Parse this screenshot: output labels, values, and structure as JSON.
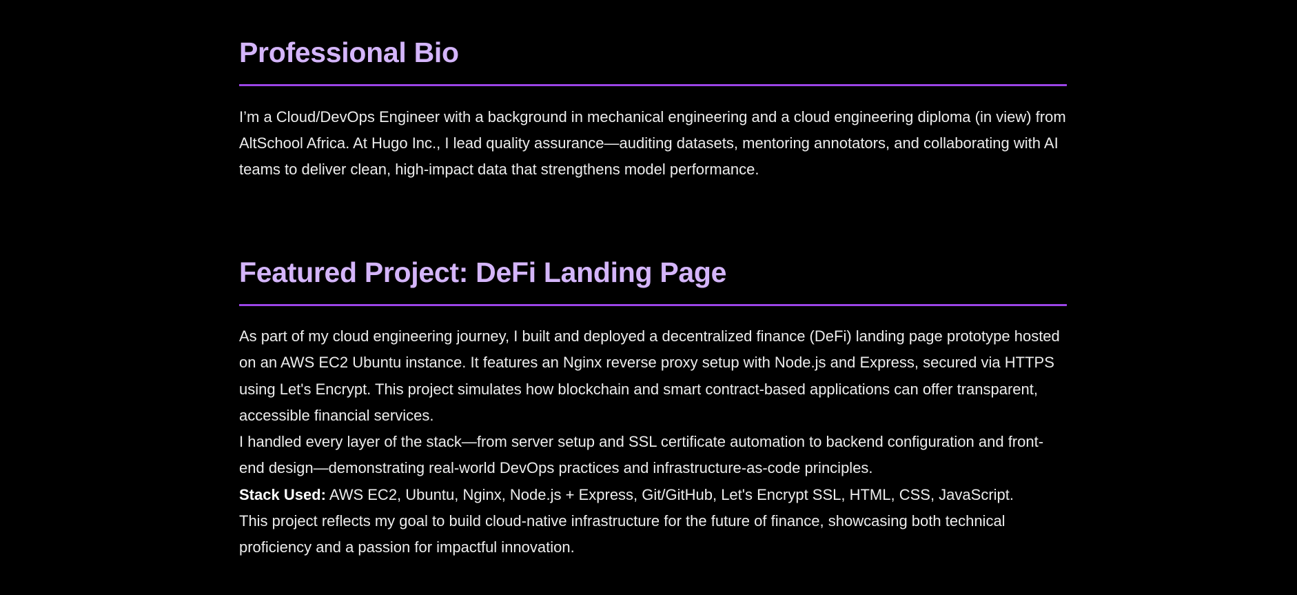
{
  "bio": {
    "title": "Professional Bio",
    "text": "I’m a Cloud/DevOps Engineer with a background in mechanical engineering and a cloud engineering diploma (in view) from AltSchool Africa. At Hugo Inc., I lead quality assurance—auditing datasets, mentoring annotators, and collaborating with AI teams to deliver clean, high-impact data that strengthens model performance."
  },
  "project": {
    "title": "Featured Project: DeFi Landing Page",
    "paragraph_1": "As part of my cloud engineering journey, I built and deployed a decentralized finance (DeFi) landing page prototype hosted on an AWS EC2 Ubuntu instance. It features an Nginx reverse proxy setup with Node.js and Express, secured via HTTPS using Let's Encrypt. This project simulates how blockchain and smart contract-based applications can offer transparent, accessible financial services.",
    "paragraph_2": "I handled every layer of the stack—from server setup and SSL certificate automation to backend configuration and front-end design—demonstrating real-world DevOps practices and infrastructure-as-code principles.",
    "stack_label": "Stack Used:",
    "stack_value": " AWS EC2, Ubuntu, Nginx, Node.js + Express, Git/GitHub, Let's Encrypt SSL, HTML, CSS, JavaScript.",
    "paragraph_4": "This project reflects my goal to build cloud-native infrastructure for the future of finance, showcasing both technical proficiency and a passion for impactful innovation."
  },
  "colors": {
    "background": "#000000",
    "heading": "#d4b5fa",
    "accent_divider": "#9b45e6",
    "body_text": "#ededed"
  }
}
